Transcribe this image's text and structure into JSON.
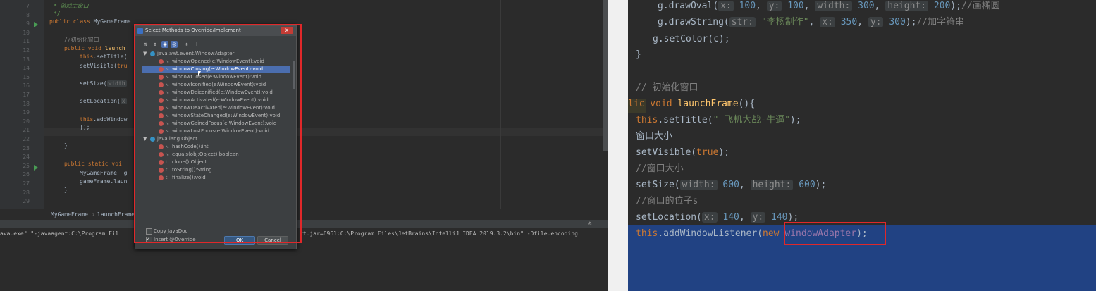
{
  "left": {
    "line_numbers": [
      "7",
      "8",
      "9",
      "10",
      "11",
      "12",
      "13",
      "14",
      "15",
      "16",
      "17",
      "18",
      "19",
      "20",
      "21",
      "22",
      "23",
      "24",
      "25",
      "26",
      "27",
      "28",
      "29"
    ],
    "code": {
      "l7": "* 游戏主窗口",
      "l8": "*/",
      "l9_kw": "public class ",
      "l9_name": "MyGameFrame",
      "l11": "//初始化窗口",
      "l12_kw": "public void ",
      "l12_fn": "launch",
      "l13_kw": "this",
      "l13": ".setTitle(",
      "l14": "setVisible(",
      "l14_kw": "tru",
      "l16": "setSize(",
      "l16_hint": "width",
      "l18": "setLocation(",
      "l18_hint": "x",
      "l20_kw": "this",
      "l20": ".addWindow",
      "l21": "});",
      "l23": "}",
      "l25_kw": "public static voi",
      "l26": "MyGameFrame",
      "l26_rest": "g",
      "l27": "gameFrame.laun",
      "l28": "}"
    },
    "breadcrumb": [
      "MyGameFrame",
      "launchFrame()"
    ],
    "console": "ava.exe\" \"-javaagent:C:\\Program Fil",
    "console_tail": "rt.jar=6961:C:\\Program Files\\JetBrains\\IntelliJ IDEA 2019.3.2\\bin\" -Dfile.encoding",
    "tool_icons": [
      "gear-icon",
      "minimize-icon"
    ]
  },
  "dialog": {
    "title": "Select Methods to Override/Implement",
    "close": "x",
    "groups": [
      {
        "name": "java.awt.event.WindowAdapter",
        "methods": [
          {
            "name": "windowOpened(e:WindowEvent):void",
            "selected": false
          },
          {
            "name": "windowClosing(e:WindowEvent):void",
            "selected": true
          },
          {
            "name": "windowClosed(e:WindowEvent):void",
            "selected": false
          },
          {
            "name": "windowIconified(e:WindowEvent):void",
            "selected": false
          },
          {
            "name": "windowDeiconified(e:WindowEvent):void",
            "selected": false
          },
          {
            "name": "windowActivated(e:WindowEvent):void",
            "selected": false
          },
          {
            "name": "windowDeactivated(e:WindowEvent):void",
            "selected": false
          },
          {
            "name": "windowStateChanged(e:WindowEvent):void",
            "selected": false
          },
          {
            "name": "windowGainedFocus(e:WindowEvent):void",
            "selected": false
          },
          {
            "name": "windowLostFocus(e:WindowEvent):void",
            "selected": false
          }
        ]
      },
      {
        "name": "java.lang.Object",
        "methods": [
          {
            "name": "hashCode():int",
            "selected": false
          },
          {
            "name": "equals(obj:Object):boolean",
            "selected": false
          },
          {
            "name": "clone():Object",
            "selected": false
          },
          {
            "name": "toString():String",
            "selected": false
          },
          {
            "name": "finalize():void",
            "selected": false
          }
        ]
      }
    ],
    "options": {
      "copy_javadoc": "Copy JavaDoc",
      "insert_override": "Insert @Override"
    },
    "ok": "OK",
    "cancel": "Cancel"
  },
  "right": {
    "l1_a": "g.drawOval(",
    "l1_h1": "x:",
    "l1_v1": "100",
    "l1_h2": "y:",
    "l1_v2": "100",
    "l1_h3": "width:",
    "l1_v3": "300",
    "l1_h4": "height:",
    "l1_v4": "200",
    "l1_cm": "//画椭圆",
    "l2_a": "g.drawString(",
    "l2_h1": "str:",
    "l2_s": "\"李杨制作\"",
    "l2_h2": "x:",
    "l2_v2": "350",
    "l2_h3": "y:",
    "l2_v3": "300",
    "l2_cm": "//加字符串",
    "l3": "g.setColor(c);",
    "l4": "}",
    "l5": "// 初始化窗口",
    "l6_kw": "lic void ",
    "l6_fn": "launchFrame",
    "l6_rest": "(){",
    "l7_kw": "this",
    "l7_a": ".setTitle(",
    "l7_s": "\" 飞机大战-牛逼\"",
    "l7_b": ");",
    "l8": "窗口大小",
    "l9_a": "setVisible(",
    "l9_kw": "true",
    "l9_b": ");",
    "l10": "//窗口大小",
    "l11_a": "setSize(",
    "l11_h1": "width:",
    "l11_v1": "600",
    "l11_h2": "height:",
    "l11_v2": "600",
    "l11_b": ");",
    "l12": "//窗口的位子s",
    "l13_a": "setLocation(",
    "l13_h1": "x:",
    "l13_v1": "140",
    "l13_h2": "y:",
    "l13_v2": "140",
    "l13_b": ");",
    "l14_kw": "this",
    "l14_a": ".addWindowListener(",
    "l14_kw2": "new ",
    "l14_cls": "windowAdapter",
    "l14_b": ");"
  }
}
